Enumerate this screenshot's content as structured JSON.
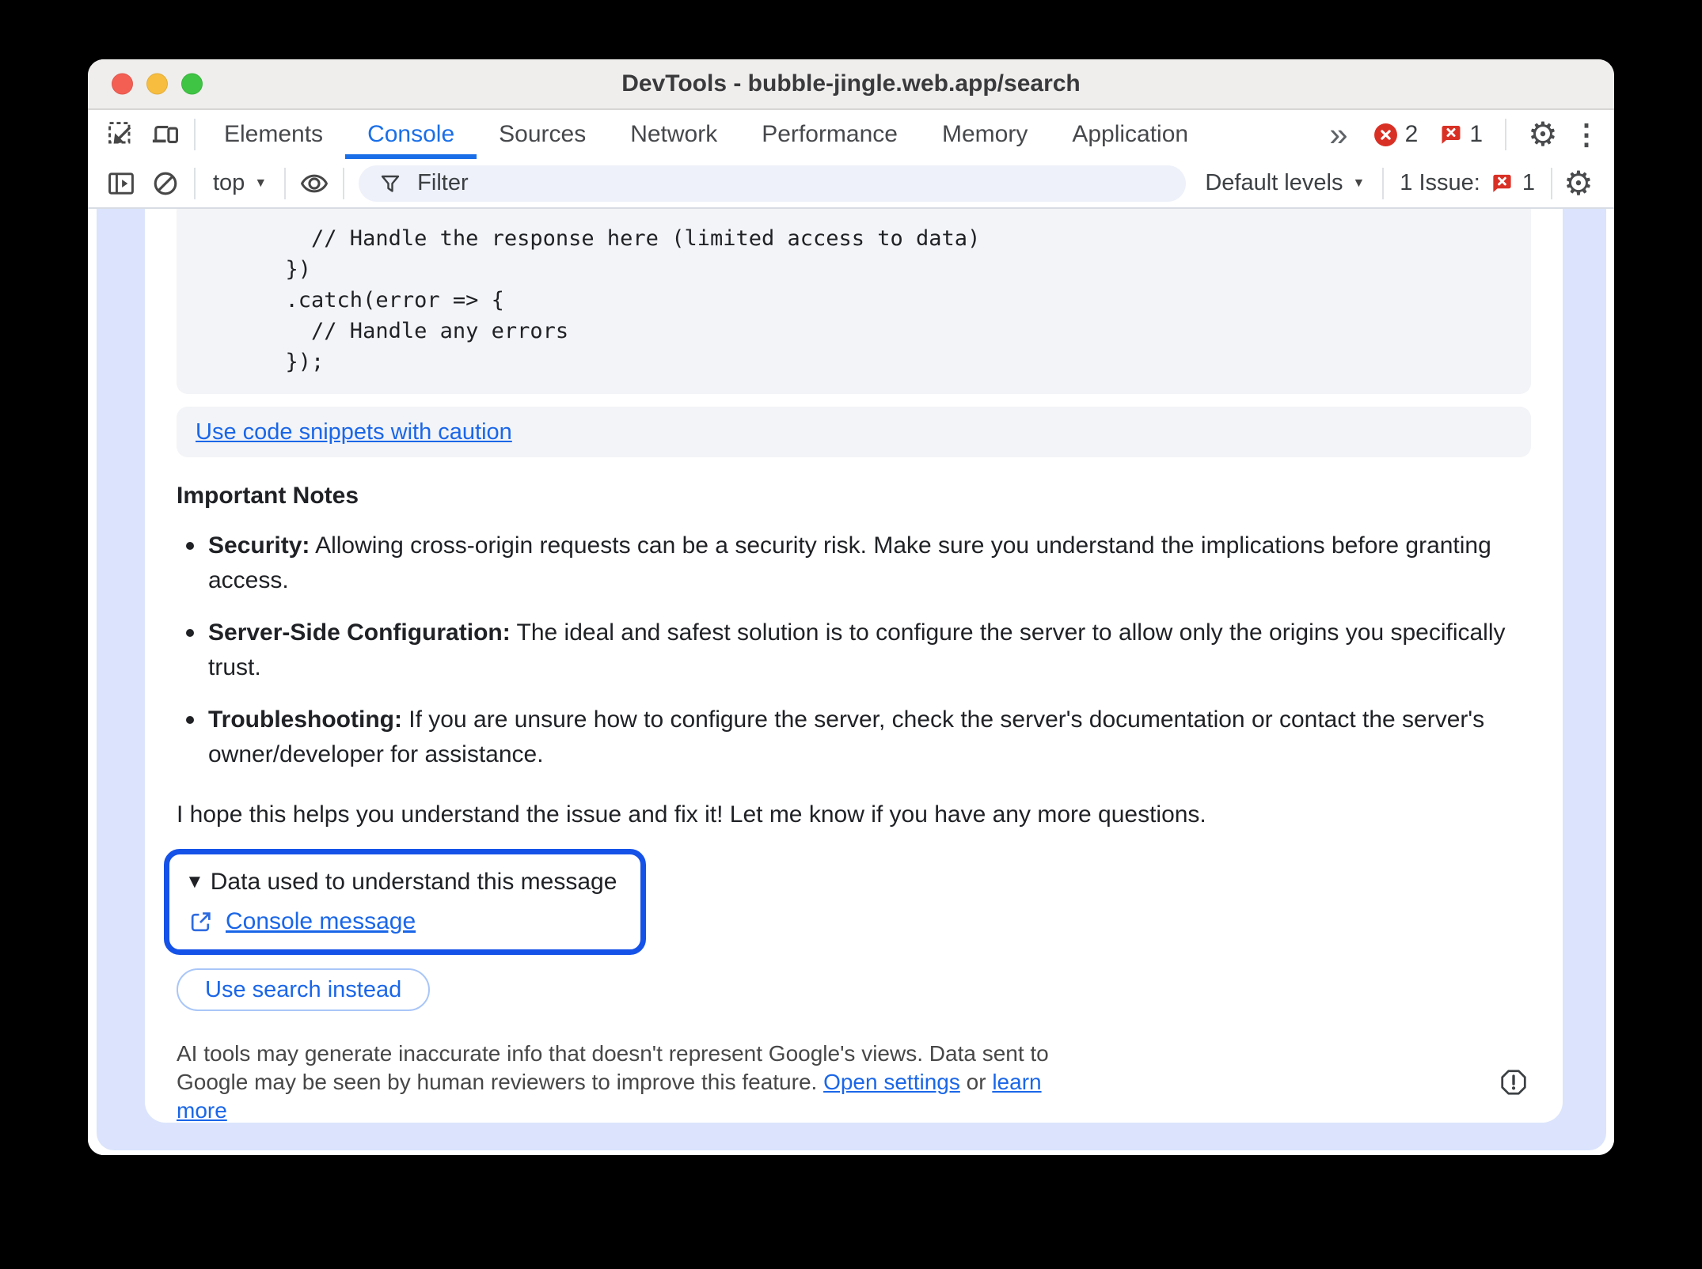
{
  "window": {
    "title": "DevTools - bubble-jingle.web.app/search"
  },
  "tabs": {
    "active_tab": "Console",
    "items": [
      {
        "label": "Elements"
      },
      {
        "label": "Console"
      },
      {
        "label": "Sources"
      },
      {
        "label": "Network"
      },
      {
        "label": "Performance"
      },
      {
        "label": "Memory"
      },
      {
        "label": "Application"
      }
    ],
    "error_count": "2",
    "issue_count": "1"
  },
  "toolbar": {
    "context_selector": "top",
    "filter_placeholder": "Filter",
    "levels_selector": "Default levels",
    "issues_label": "1 Issue:",
    "issues_count": "1"
  },
  "insight": {
    "code_lines": [
      "        // Handle the response here (limited access to data)",
      "      })",
      "      .catch(error => {",
      "        // Handle any errors",
      "      });"
    ],
    "caution_link": "Use code snippets with caution",
    "notes_title": "Important Notes",
    "bullets": [
      {
        "lead": "Security:",
        "text": " Allowing cross-origin requests can be a security risk. Make sure you understand the implications before granting access."
      },
      {
        "lead": "Server-Side Configuration:",
        "text": " The ideal and safest solution is to configure the server to allow only the origins you specifically trust."
      },
      {
        "lead": "Troubleshooting:",
        "text": " If you are unsure how to configure the server, check the server's documentation or contact the server's owner/developer for assistance."
      }
    ],
    "closing": "I hope this helps you understand the issue and fix it! Let me know if you have any more questions.",
    "data_section": {
      "title": "Data used to understand this message",
      "link": "Console message"
    },
    "search_button": "Use search instead",
    "disclaimer": {
      "text": "AI tools may generate inaccurate info that doesn't represent Google's views. Data sent to Google may be seen by human reviewers to improve this feature. ",
      "settings_link": "Open settings",
      "separator": " or ",
      "learn_link": "learn more"
    }
  },
  "icons": {
    "gear": "⚙",
    "more-vertical": "⋮",
    "more-tabs": "»",
    "caret-down": "▼",
    "disclosure-down": "▼"
  },
  "colors": {
    "accent_blue": "#1a66e8",
    "tab_blue": "#1a6fe8",
    "highlight_border": "#1552e8",
    "panel_blue": "#dbe4fc",
    "error_red": "#d93025"
  }
}
